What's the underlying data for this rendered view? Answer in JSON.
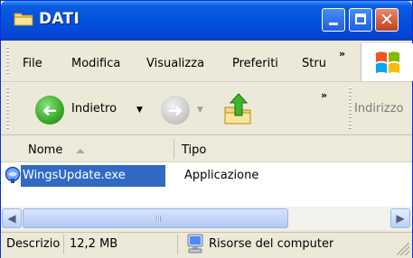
{
  "window": {
    "title": "DATI",
    "close_glyph": "✕"
  },
  "menubar": {
    "items": [
      "File",
      "Modifica",
      "Visualizza",
      "Preferiti",
      "Stru"
    ],
    "more": "»"
  },
  "toolbar": {
    "back_label": "Indietro",
    "back_arrow": "➜",
    "fwd_arrow": "➜",
    "dropdown": "▼",
    "more": "»",
    "address_label": "Indirizzo"
  },
  "list": {
    "columns": [
      "Nome",
      "Tipo"
    ],
    "rows": [
      {
        "name": "WingsUpdate.exe",
        "type": "Applicazione"
      }
    ]
  },
  "scrollbar": {
    "left_arrow": "◀",
    "right_arrow": "▶"
  },
  "status": {
    "description": "Descrizio",
    "size": "12,2 MB",
    "location": "Risorse del computer"
  },
  "icons": {
    "folder": "folder-icon",
    "winlogo": "windows-logo-icon",
    "back": "back-arrow-icon",
    "forward": "forward-arrow-icon",
    "up": "up-folder-icon",
    "app": "application-icon",
    "computer": "computer-icon"
  },
  "colors": {
    "titlebar": "#0553e0",
    "selection": "#316ac5",
    "close": "#c2401a"
  }
}
